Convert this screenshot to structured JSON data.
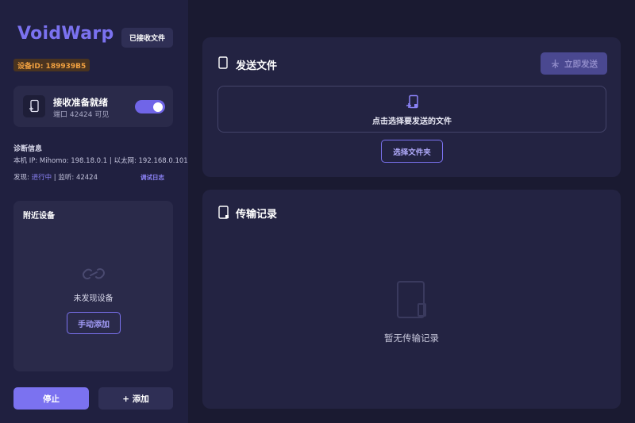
{
  "app": {
    "logo": "VoidWarp",
    "received_files_button": "已接收文件",
    "device_id": "设备ID: 189939B5"
  },
  "status": {
    "title": "接收准备就绪",
    "subtitle": "端口 42424 可见",
    "toggle_on": true
  },
  "diagnostics": {
    "title": "诊断信息",
    "line1": "本机 IP: Mihomo: 198.18.0.1 | 以太网: 192.168.0.101 |",
    "discovery_label": "发现:",
    "discovery_value": "进行中",
    "listen_label": "| 监听:",
    "listen_value": "42424",
    "debug_log": "调试日志"
  },
  "nearby": {
    "title": "附近设备",
    "empty_text": "未发现设备",
    "manual_add": "手动添加"
  },
  "footer": {
    "stop": "停止",
    "add": "+ 添加"
  },
  "send": {
    "title": "发送文件",
    "send_now": "立即发送",
    "drop_text": "点击选择要发送的文件",
    "choose_folder": "选择文件夹"
  },
  "history": {
    "title": "传输记录",
    "empty_text": "暂无传输记录"
  },
  "colors": {
    "accent": "#7b72f0",
    "sidebar_bg": "#202040",
    "main_bg": "#1a1a31",
    "card_bg": "#232342",
    "device_id_text": "#f0a040"
  },
  "icons": {
    "status": "file-receive-icon",
    "nearby_empty": "link-icon",
    "send": "file-icon",
    "drop": "file-add-icon",
    "send_now": "plane-icon",
    "history": "file-icon",
    "history_empty": "file-empty-icon"
  }
}
